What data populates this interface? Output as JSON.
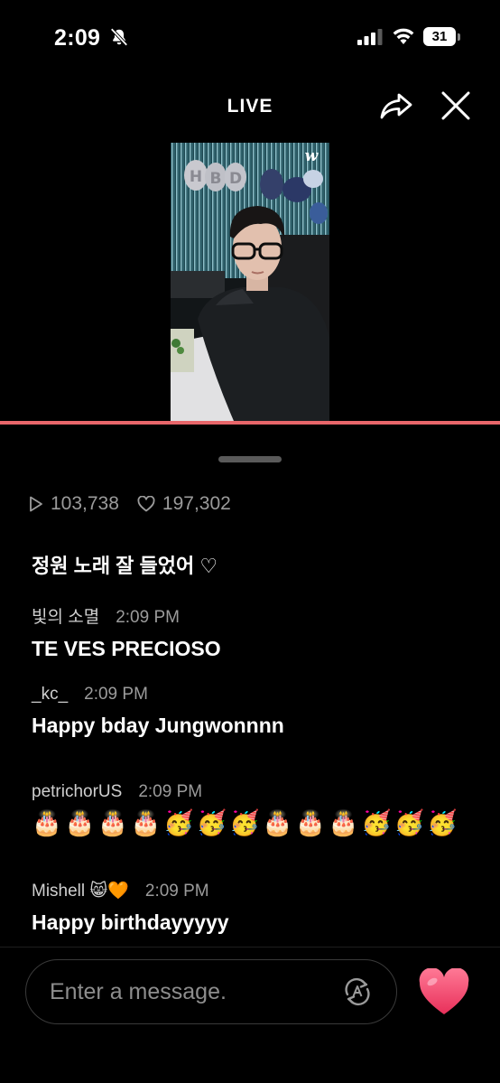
{
  "status_bar": {
    "time": "2:09",
    "battery": "31"
  },
  "header": {
    "title": "LIVE"
  },
  "video": {
    "watermark": "w",
    "balloon_letters": [
      "H",
      "B",
      "D"
    ],
    "progress": 1.0
  },
  "stats": {
    "views": "103,738",
    "likes": "197,302"
  },
  "chat": [
    {
      "user": "",
      "time": "",
      "text": "정원 노래 잘 들었어 ♡"
    },
    {
      "user": "빛의 소멸",
      "time": "2:09 PM",
      "text": "TE VES PRECIOSO"
    },
    {
      "user": "_kc_",
      "time": "2:09 PM",
      "text": "Happy bday Jungwonnnn"
    },
    {
      "user": "petrichorUS",
      "time": "2:09 PM",
      "emojis": [
        "🎂",
        "🎂",
        "🎂",
        "🎂",
        "🥳",
        "🥳",
        "🥳",
        "🎂",
        "🎂",
        "🎂",
        "🥳",
        "🥳",
        "🥳"
      ]
    },
    {
      "user": "Mishell 😸🧡",
      "time": "2:09 PM",
      "text": "Happy birthdayyyyy"
    }
  ],
  "composer": {
    "placeholder": "Enter a message."
  },
  "colors": {
    "accent": "#e8666a",
    "heart": "#f0446a",
    "background": "#000000"
  },
  "icons": [
    "bell-slash-icon",
    "signal-icon",
    "wifi-icon",
    "battery-icon",
    "share-icon",
    "close-icon",
    "play-icon",
    "heart-outline-icon",
    "translate-icon",
    "heart-icon"
  ]
}
